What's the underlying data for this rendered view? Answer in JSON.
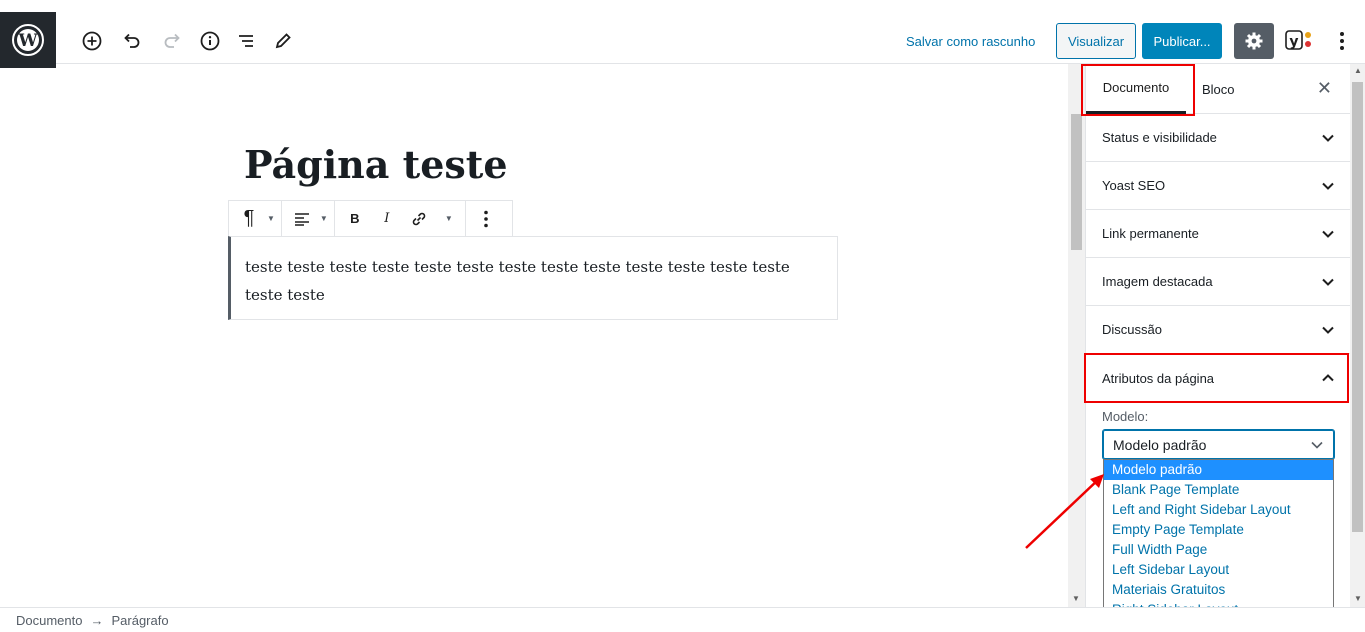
{
  "toolbar": {
    "save_draft": "Salvar como rascunho",
    "preview": "Visualizar",
    "publish": "Publicar..."
  },
  "editor": {
    "title": "Página teste",
    "paragraph": "teste teste teste teste teste teste teste teste teste teste teste teste teste teste teste"
  },
  "sidebar": {
    "tabs": [
      {
        "label": "Documento",
        "active": true
      },
      {
        "label": "Bloco",
        "active": false
      }
    ],
    "panels": [
      {
        "label": "Status e visibilidade"
      },
      {
        "label": "Yoast SEO"
      },
      {
        "label": "Link permanente"
      },
      {
        "label": "Imagem destacada"
      },
      {
        "label": "Discussão"
      },
      {
        "label": "Atributos da página"
      }
    ],
    "template_label": "Modelo:",
    "template_value": "Modelo padrão",
    "template_options": [
      "Modelo padrão",
      "Blank Page Template",
      "Left and Right Sidebar Layout",
      "Empty Page Template",
      "Full Width Page",
      "Left Sidebar Layout",
      "Materiais Gratuitos",
      "Right Sidebar Layout"
    ]
  },
  "breadcrumb": {
    "items": [
      "Documento",
      "Parágrafo"
    ],
    "separator": "→"
  },
  "colors": {
    "accent": "#0073aa",
    "publish": "#0085ba",
    "highlight": "#e00000",
    "selected_option": "#1e90ff"
  },
  "icons": [
    "wordpress-logo-icon",
    "add-block-icon",
    "undo-icon",
    "redo-icon",
    "info-icon",
    "outline-icon",
    "edit-icon",
    "settings-icon",
    "yoast-icon",
    "more-icon"
  ]
}
